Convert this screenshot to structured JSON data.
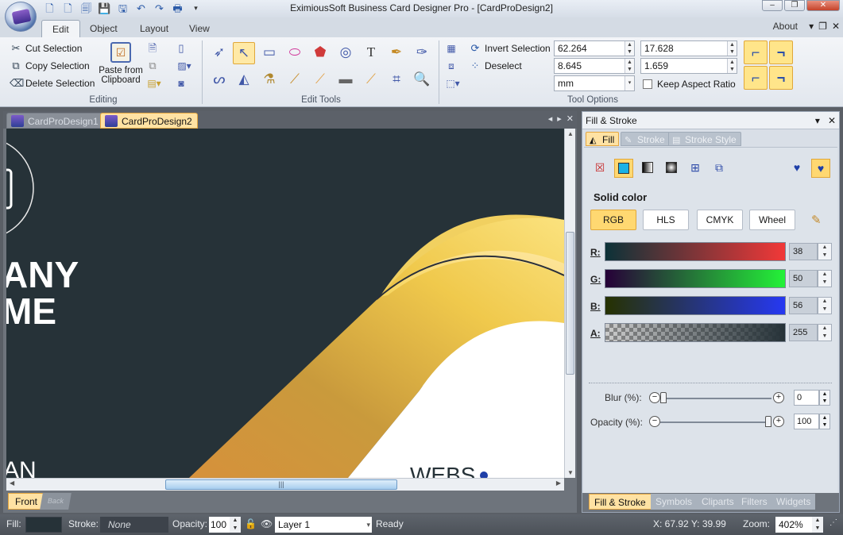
{
  "window": {
    "title": "EximiousSoft Business Card Designer Pro - [CardProDesign2]",
    "controls": [
      "–",
      "❐",
      "✕"
    ]
  },
  "ribbon": {
    "tabs": [
      "Edit",
      "Object",
      "Layout",
      "View"
    ],
    "active_tab": "Edit",
    "about": "About",
    "mdi_controls": [
      "▾",
      "❐",
      "✕"
    ],
    "editing": {
      "cut": "Cut Selection",
      "copy": "Copy Selection",
      "delete": "Delete Selection",
      "paste_line1": "Paste from",
      "paste_line2": "Clipboard",
      "label": "Editing"
    },
    "edit_tools": {
      "label": "Edit Tools"
    },
    "tool_options": {
      "invert": "Invert Selection",
      "deselect": "Deselect",
      "x": "62.264",
      "y": "8.645",
      "width": "17.628",
      "height": "1.659",
      "unit": "mm",
      "keep_aspect": "Keep Aspect Ratio",
      "label": "Tool Options"
    }
  },
  "document": {
    "tabs": [
      "CardProDesign1",
      "CardProDesign2"
    ],
    "active_tab": "CardProDesign2",
    "card": {
      "text_line1": "ANY",
      "text_line2": "ME",
      "text_bottom_left": "AN",
      "text_bottom_right": "WEBS"
    },
    "pages": [
      "Front",
      "Back"
    ],
    "active_page": "Front"
  },
  "panel": {
    "title": "Fill & Stroke",
    "tabs": [
      "Fill",
      "Stroke",
      "Stroke Style"
    ],
    "active_tab": "Fill",
    "fill_type_label": "Solid color",
    "modes": [
      "RGB",
      "HLS",
      "CMYK",
      "Wheel"
    ],
    "active_mode": "RGB",
    "channels": [
      {
        "label": "R:",
        "value": "38"
      },
      {
        "label": "G:",
        "value": "50"
      },
      {
        "label": "B:",
        "value": "56"
      },
      {
        "label": "A:",
        "value": "255"
      }
    ],
    "blur_label": "Blur (%):",
    "blur_value": "0",
    "blur_level": 0.0,
    "opacity_label": "Opacity (%):",
    "opacity_value": "100",
    "opacity_level": 1.0,
    "bottom_tabs": [
      "Fill & Stroke",
      "Symbols",
      "Cliparts",
      "Filters",
      "Widgets"
    ],
    "active_bottom_tab": "Fill & Stroke"
  },
  "status": {
    "fill_label": "Fill:",
    "stroke_label": "Stroke:",
    "stroke_value": "None",
    "opacity_label": "Opacity:",
    "opacity_value": "100",
    "layer": "Layer 1",
    "ready": "Ready",
    "coords": "X: 67.92 Y: 39.99",
    "zoom_label": "Zoom:",
    "zoom_value": "402%"
  },
  "colors": {
    "card_background": "#263238",
    "gold_light": "#f6d86b",
    "gold_dark": "#d79a3a",
    "accent_selected": "#ffd871"
  }
}
